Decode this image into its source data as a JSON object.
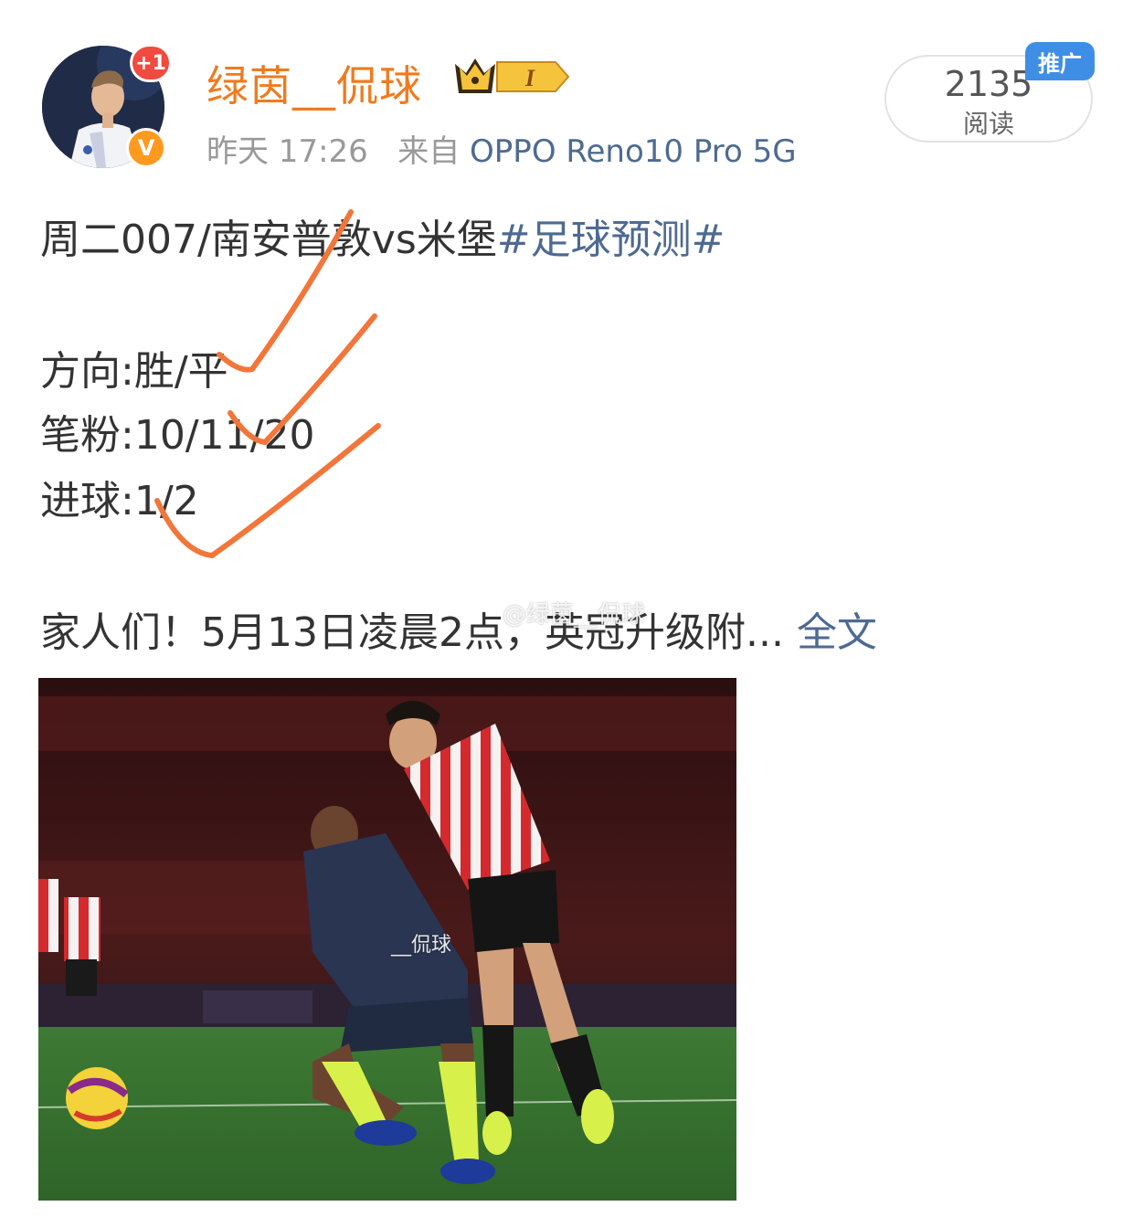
{
  "post": {
    "author": {
      "name": "绿茵__侃球",
      "level_badge": "I",
      "notification_badge": "+1",
      "verified_badge": "V"
    },
    "meta": {
      "time": "昨天 17:26",
      "source_prefix": "来自",
      "source": "OPPO Reno10 Pro 5G"
    },
    "reads": {
      "count": "2135",
      "label": "阅读",
      "promo_tag": "推广"
    },
    "content": {
      "match_line": "周二007/南安普敦vs米堡",
      "hashtag": "#足球预测#",
      "direction": "方向:胜/平",
      "scores": "笔粉:10/11/20",
      "goals": "进球:1/2",
      "teaser": "家人们！5月13日凌晨2点，英冠升级附...",
      "full_text_link": "全文"
    },
    "image_watermark": "@绿茵__侃球",
    "photo_watermark": "__侃球"
  },
  "colors": {
    "username": "#f07a1e",
    "link": "#4d6a92",
    "check_marks": "#f2763a",
    "promo": "#3f8ee6"
  }
}
